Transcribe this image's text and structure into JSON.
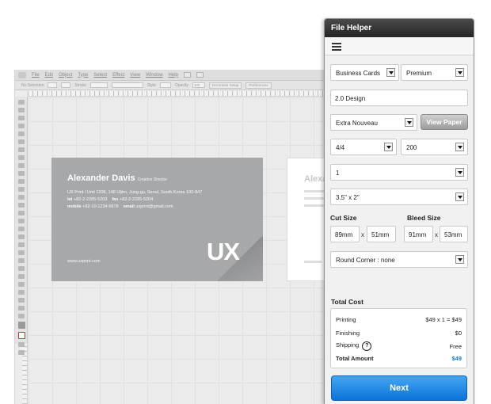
{
  "workspace": {
    "menu": [
      "File",
      "Edit",
      "Object",
      "Type",
      "Select",
      "Effect",
      "View",
      "Window",
      "Help"
    ],
    "control": {
      "selection": "No Selection",
      "stroke": "Stroke",
      "style": "Style",
      "opacity_label": "Opacity",
      "opacity_value": "100",
      "document_setup": "Document Setup",
      "preferences": "Preferences"
    }
  },
  "card": {
    "name": "Alexander Davis",
    "role": "Creative Director",
    "address": "UX Print / Unit 1206, 148 Uljiro, Jung-gu, Seoul, South Korea 100-847",
    "tel_label": "tel",
    "tel": "+82-2-2285-5203",
    "fax_label": "fax",
    "fax": "+82-2-2285-5204",
    "mobile_label": "mobile",
    "mobile": "+82-10-1234-5678",
    "email_label": "email",
    "email": "uxprint@gmail.com",
    "website": "www.uxprint.com",
    "logo": "UX",
    "back_name": "Alexa"
  },
  "panel": {
    "title": "File Helper",
    "product": "Business Cards",
    "grade": "Premium",
    "design": "2.0 Design",
    "paper": "Extra Nouveau",
    "view_paper": "View Paper",
    "color": "4/4",
    "quantity": "200",
    "sets": "1",
    "size": "3.5\" x 2\"",
    "cut_size_label": "Cut Size",
    "bleed_size_label": "Bleed Size",
    "cut_w": "89mm",
    "cut_h": "51mm",
    "bleed_w": "91mm",
    "bleed_h": "53mm",
    "x": "x",
    "corner": "Round Corner : none",
    "total_cost_label": "Total Cost",
    "printing_label": "Printing",
    "printing_value": "$49 x 1 = $49",
    "finishing_label": "Finishing",
    "finishing_value": "$0",
    "shipping_label": "Shipping",
    "shipping_value": "Free",
    "total_label": "Total Amount",
    "total_value": "$49",
    "next": "Next",
    "help": "?"
  },
  "colors": {
    "accent": "#1779d6",
    "next_button": "#1a85e6",
    "card_bg": "#a7a8aa"
  }
}
